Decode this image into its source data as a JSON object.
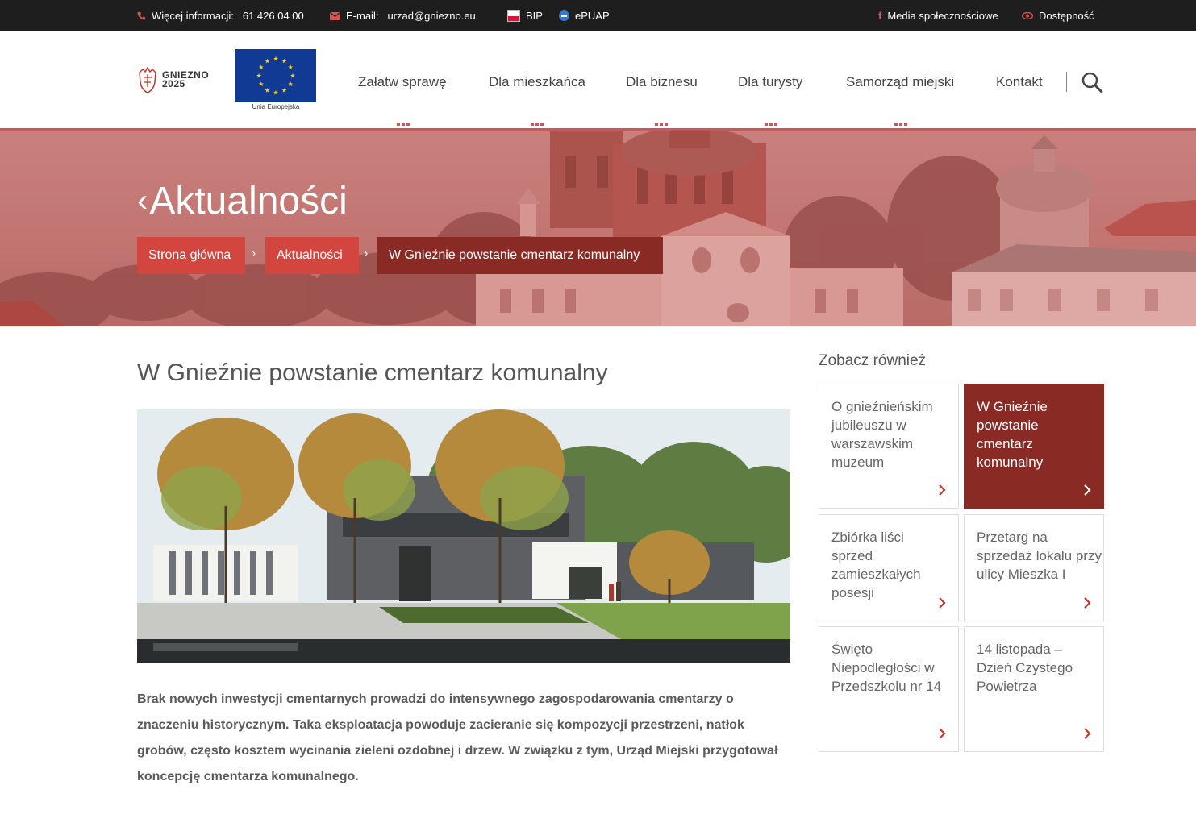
{
  "topbar": {
    "info_label": "Więcej informacji:",
    "info_phone": "61 426 04 00",
    "email_label": "E-mail:",
    "email_value": "urzad@gniezno.eu",
    "bip": "BIP",
    "epuap": "ePUAP",
    "social": "Media społecznościowe",
    "accessibility": "Dostępność"
  },
  "header": {
    "logo_line1": "GNIEZNO",
    "logo_line2": "2025",
    "eu_caption": "Unia Europejska",
    "nav": [
      "Załatw sprawę",
      "Dla mieszkańca",
      "Dla biznesu",
      "Dla turysty",
      "Samorząd miejski",
      "Kontakt"
    ]
  },
  "hero": {
    "title": "Aktualności",
    "breadcrumb": [
      "Strona główna",
      "Aktualności",
      "W Gnieźnie powstanie cmentarz komunalny"
    ]
  },
  "article": {
    "title": "W Gnieźnie powstanie cmentarz komunalny",
    "body": "Brak nowych inwestycji cmentarnych prowadzi do intensywnego zagospodarowania cmentarzy o znaczeniu historycznym. Taka eksploatacja powoduje zacieranie się kompozycji przestrzeni, natłok grobów, często kosztem wycinania zieleni ozdobnej i drzew. W związku z tym, Urząd Miejski przygotował koncepcję cmentarza komunalnego."
  },
  "sidebar": {
    "heading": "Zobacz również",
    "cards": [
      {
        "title": "O gnieźnieńskim jubileuszu w warszawskim muzeum",
        "active": false
      },
      {
        "title": "W Gnieźnie powstanie cmentarz komunalny",
        "active": true
      },
      {
        "title": "Zbiórka liści sprzed zamieszkałych posesji",
        "active": false
      },
      {
        "title": "Przetarg na sprzedaż lokalu przy ulicy Mieszka I",
        "active": false
      },
      {
        "title": "Święto Niepodległości w Przedszkolu nr 14",
        "active": false
      },
      {
        "title": "14 listopada – Dzień Czystego Powietrza",
        "active": false
      }
    ]
  },
  "colors": {
    "accent": "#d2463f",
    "accent_dark": "#8a2a25",
    "topbar_bg": "#1e1e1e"
  }
}
